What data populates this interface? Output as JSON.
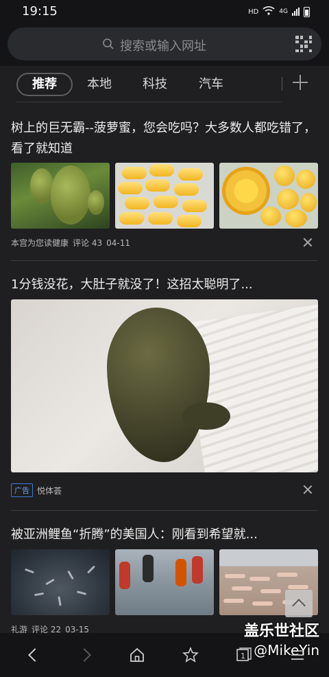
{
  "status_bar": {
    "time": "19:15",
    "network": "HD",
    "signal": "4G"
  },
  "search": {
    "placeholder": "搜索或输入网址",
    "icon": "search-icon",
    "qr_icon": "qr-code-icon"
  },
  "tabs": [
    {
      "label": "推荐",
      "active": true
    },
    {
      "label": "本地",
      "active": false
    },
    {
      "label": "科技",
      "active": false
    },
    {
      "label": "汽车",
      "active": false
    }
  ],
  "feed": [
    {
      "title": "树上的巨无霸--菠萝蜜，您会吃吗？大多数人都吃错了，看了就知道",
      "source": "本宫为您读健康",
      "comments": "评论 43",
      "date": "04-11",
      "images": [
        "jackfruit-on-tree",
        "jackfruit-bulbs",
        "jackfruit-on-plate"
      ]
    },
    {
      "title": "1分钱没花，大肚子就没了！这招太聪明了...",
      "ad_label": "广告",
      "source": "悦体荟",
      "images": [
        "brown-lump-on-cloth"
      ]
    },
    {
      "title": "被亚洲鲤鱼“折腾”的美国人：刚看到希望就...",
      "source": "礼游",
      "comments": "评论 22",
      "date": "03-15",
      "images": [
        "carp-in-water",
        "people-catching-carp",
        "carp-on-shore"
      ]
    }
  ],
  "watermark": {
    "line1": "盖乐世社区",
    "line2": "@MikeYin"
  },
  "bottom_nav": [
    "back-icon",
    "forward-icon",
    "home-icon",
    "bookmark-star-icon",
    "tabs-icon",
    "menu-icon"
  ],
  "bottom_nav_tab_count": "1"
}
